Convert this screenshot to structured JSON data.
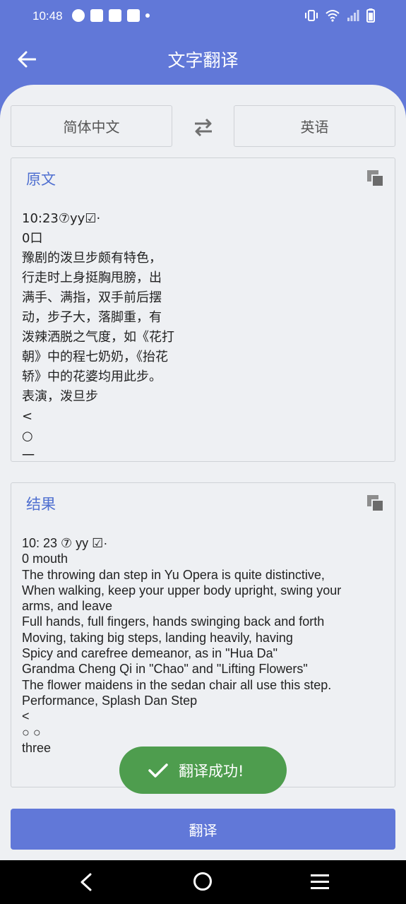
{
  "status_bar": {
    "time": "10:48",
    "left_icons": [
      "speedometer-icon",
      "mail-icon",
      "mail-icon",
      "mail-icon",
      "dot-icon"
    ],
    "right_icons": [
      "vibrate-icon",
      "wifi-icon",
      "signal-icon",
      "battery-icon"
    ]
  },
  "app_bar": {
    "back_icon": "arrow-left-icon",
    "title": "文字翻译"
  },
  "language": {
    "source": "简体中文",
    "target": "英语",
    "swap_icon": "swap-icon"
  },
  "source_card": {
    "title": "原文",
    "copy_icon": "copy-icon",
    "text": "10:23⑦yy☑·\n0口\n豫剧的泼旦步颇有特色，\n行走时上身挺胸甩膀，出\n满手、满指，双手前后摆\n动，步子大，落脚重，有\n泼辣洒脱之气度，如《花打\n朝》中的程七奶奶，《抬花\n轿》中的花婆均用此步。\n表演，泼旦步\n<\n○\n一"
  },
  "result_card": {
    "title": "结果",
    "copy_icon": "copy-icon",
    "text": "10: 23 ⑦ yy ☑·\n0 mouth\nThe throwing dan step in Yu Opera is quite distinctive,\nWhen walking, keep your upper body upright, swing your arms, and leave\nFull hands, full fingers, hands swinging back and forth\nMoving, taking big steps, landing heavily, having\nSpicy and carefree demeanor, as in \"Hua Da\"\nGrandma Cheng Qi in \"Chao\" and \"Lifting Flowers\"\nThe flower maidens in the sedan chair all use this step.\nPerformance, Splash Dan Step\n<\n○ ○\nthree"
  },
  "toast": {
    "icon": "check-icon",
    "message": "翻译成功!",
    "color": "#4e9d4e"
  },
  "translate_button": {
    "label": "翻译"
  },
  "colors": {
    "primary": "#6178d8",
    "background": "#eef0f3",
    "accent_text": "#4f6fd0"
  },
  "nav_bar": {
    "icons": [
      "nav-back-icon",
      "nav-home-icon",
      "nav-menu-icon"
    ]
  }
}
